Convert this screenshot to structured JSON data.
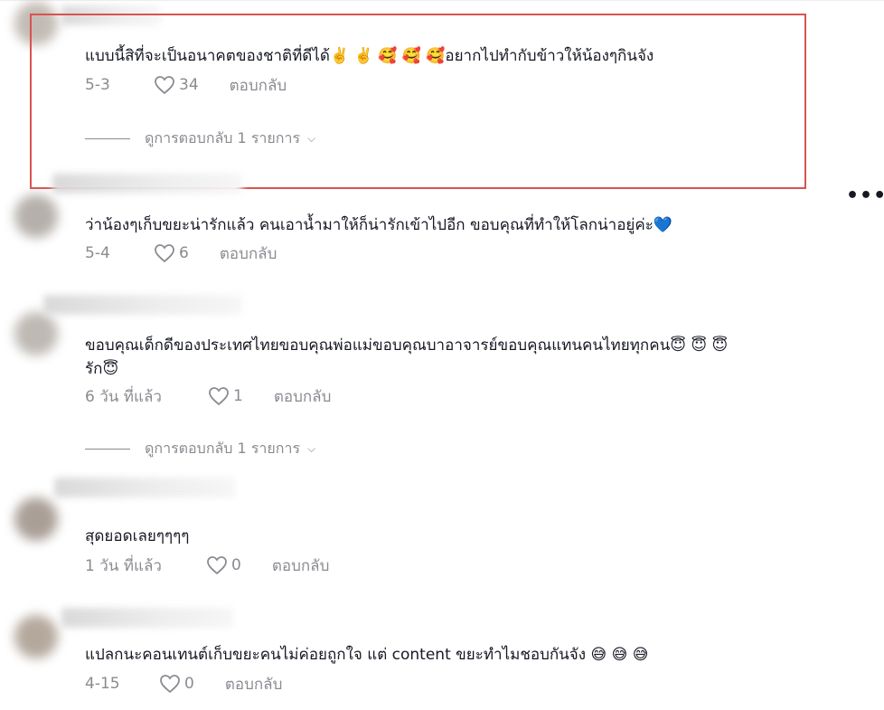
{
  "comments": [
    {
      "text": "แบบนี้สิที่จะเป็นอนาคตของชาติที่ดีได้",
      "emoji": "✌️ ✌️ 🥰 🥰 🥰",
      "text_tail": "อยากไปทำกับข้าวให้น้องๆกินจัง",
      "date": "5-3",
      "likes": "34",
      "reply": "ตอบกลับ",
      "view_replies": "ดูการตอบกลับ 1 รายการ"
    },
    {
      "text": "ว่าน้องๆเก็บขยะน่ารักแล้ว คนเอาน้ำมาให้ก็น่ารักเข้าไปอีก ขอบคุณที่ทำให้โลกน่าอยู่ค่ะ",
      "emoji": "💙",
      "date": "5-4",
      "likes": "6",
      "reply": "ตอบกลับ"
    },
    {
      "text": "ขอบคุณเด็กดีของประเทศไทยขอบคุณพ่อแม่ขอบคุณบาอาจารย์ขอบคุณแทนคนไทยทุกคน",
      "emoji": "😇 😇 😇",
      "text_line2": "รัก",
      "emoji_line2": "😇",
      "date": "6 วัน ที่แล้ว",
      "likes": "1",
      "reply": "ตอบกลับ",
      "view_replies": "ดูการตอบกลับ 1 รายการ"
    },
    {
      "text": "สุดยอดเลยๆๆๆๆ",
      "date": "1 วัน ที่แล้ว",
      "likes": "0",
      "reply": "ตอบกลับ"
    },
    {
      "text": "แปลกนะคอนเทนต์เก็บขยะคนไม่ค่อยถูกใจ แต่ content ขยะทำไมชอบกันจัง",
      "emoji": "😅 😅 😅",
      "date": "4-15",
      "likes": "0",
      "reply": "ตอบกลับ"
    }
  ],
  "more_glyph": "•••",
  "icons": {
    "heart": "heart-outline-icon",
    "chevron": "chevron-down-icon",
    "more": "more-dots-icon"
  },
  "colors": {
    "text": "#161823",
    "meta": "#8a8b91",
    "highlight": "#d9534f"
  }
}
